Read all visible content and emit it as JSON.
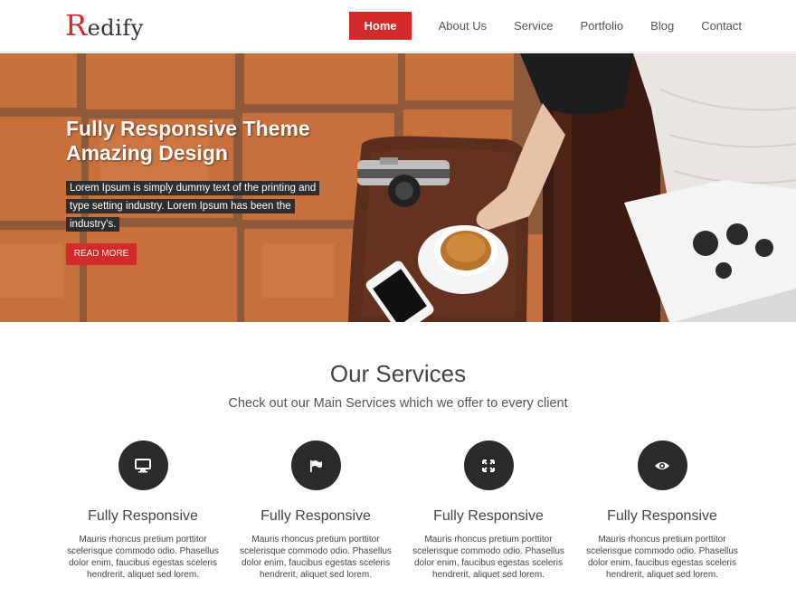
{
  "brand": {
    "logo_cap": "R",
    "logo_rest": "edify",
    "accent": "#d32a2a"
  },
  "nav": {
    "items": [
      {
        "label": "Home",
        "active": true
      },
      {
        "label": "About Us"
      },
      {
        "label": "Service"
      },
      {
        "label": "Portfolio"
      },
      {
        "label": "Blog"
      },
      {
        "label": "Contact"
      }
    ]
  },
  "hero": {
    "title_line1": "Fully Responsive Theme",
    "title_line2": "Amazing Design",
    "text": "Lorem Ipsum is simply dummy text of the printing and type setting industry. Lorem Ipsum has been the industry's.",
    "button": "READ MORE"
  },
  "services": {
    "title": "Our Services",
    "subtitle": "Check out our Main Services which we offer to every client",
    "items": [
      {
        "icon": "monitor-icon",
        "title": "Fully Responsive",
        "text": "Mauris rhoncus pretium porttitor scelerisque commodo odio. Phasellus dolor enim, faucibus egestas sceleris hendrerit, aliquet sed lorem."
      },
      {
        "icon": "flag-icon",
        "title": "Fully Responsive",
        "text": "Mauris rhoncus pretium porttitor scelerisque commodo odio. Phasellus dolor enim, faucibus egestas sceleris hendrerit, aliquet sed lorem."
      },
      {
        "icon": "expand-icon",
        "title": "Fully Responsive",
        "text": "Mauris rhoncus pretium porttitor scelerisque commodo odio. Phasellus dolor enim, faucibus egestas sceleris hendrerit, aliquet sed lorem."
      },
      {
        "icon": "eye-icon",
        "title": "Fully Responsive",
        "text": "Mauris rhoncus pretium porttitor scelerisque commodo odio. Phasellus dolor enim, faucibus egestas sceleris hendrerit, aliquet sed lorem."
      }
    ]
  }
}
